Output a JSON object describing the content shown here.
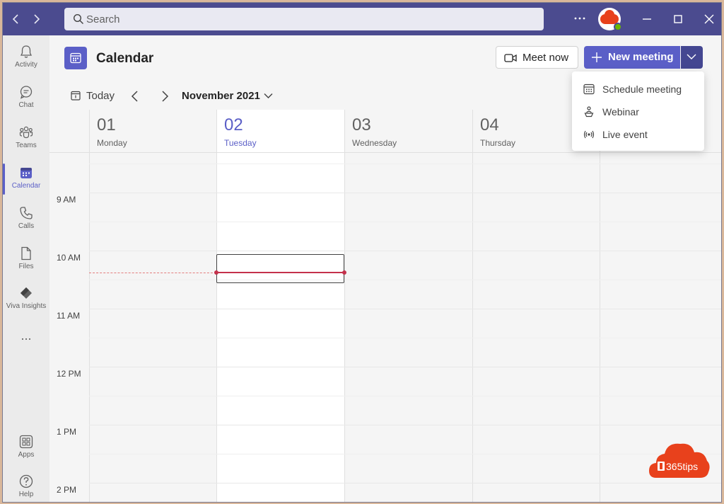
{
  "titlebar": {
    "back_icon": "chevron-left-icon",
    "forward_icon": "chevron-right-icon",
    "search_placeholder": "Search",
    "more_icon": "more-horizontal-icon"
  },
  "rail": {
    "items": [
      {
        "label": "Activity",
        "icon": "bell-icon"
      },
      {
        "label": "Chat",
        "icon": "chat-icon"
      },
      {
        "label": "Teams",
        "icon": "teams-icon"
      },
      {
        "label": "Calendar",
        "icon": "calendar-icon",
        "active": true
      },
      {
        "label": "Calls",
        "icon": "phone-icon"
      },
      {
        "label": "Files",
        "icon": "file-icon"
      },
      {
        "label": "Viva Insights",
        "icon": "viva-insights-icon"
      }
    ],
    "more": "...",
    "apps_label": "Apps",
    "help_label": "Help"
  },
  "header": {
    "title": "Calendar",
    "meet_now": "Meet now",
    "new_meeting": "New meeting"
  },
  "toolbar": {
    "today": "Today",
    "month": "November 2021"
  },
  "days": [
    {
      "num": "01",
      "name": "Monday"
    },
    {
      "num": "02",
      "name": "Tuesday",
      "today": true
    },
    {
      "num": "03",
      "name": "Wednesday"
    },
    {
      "num": "04",
      "name": "Thursday"
    }
  ],
  "times": [
    "9 AM",
    "10 AM",
    "11 AM",
    "12 PM",
    "1 PM",
    "2 PM"
  ],
  "dropdown": {
    "items": [
      {
        "label": "Schedule meeting",
        "icon": "calendar-grid-icon"
      },
      {
        "label": "Webinar",
        "icon": "presenter-icon"
      },
      {
        "label": "Live event",
        "icon": "broadcast-icon"
      }
    ]
  },
  "watermark": {
    "text": "365tips"
  },
  "colors": {
    "titlebar": "#4b4b8f",
    "brand": "#5b5fc7",
    "brand_dark": "#444791",
    "now_line": "#c4314b",
    "watermark": "#e8411c"
  }
}
